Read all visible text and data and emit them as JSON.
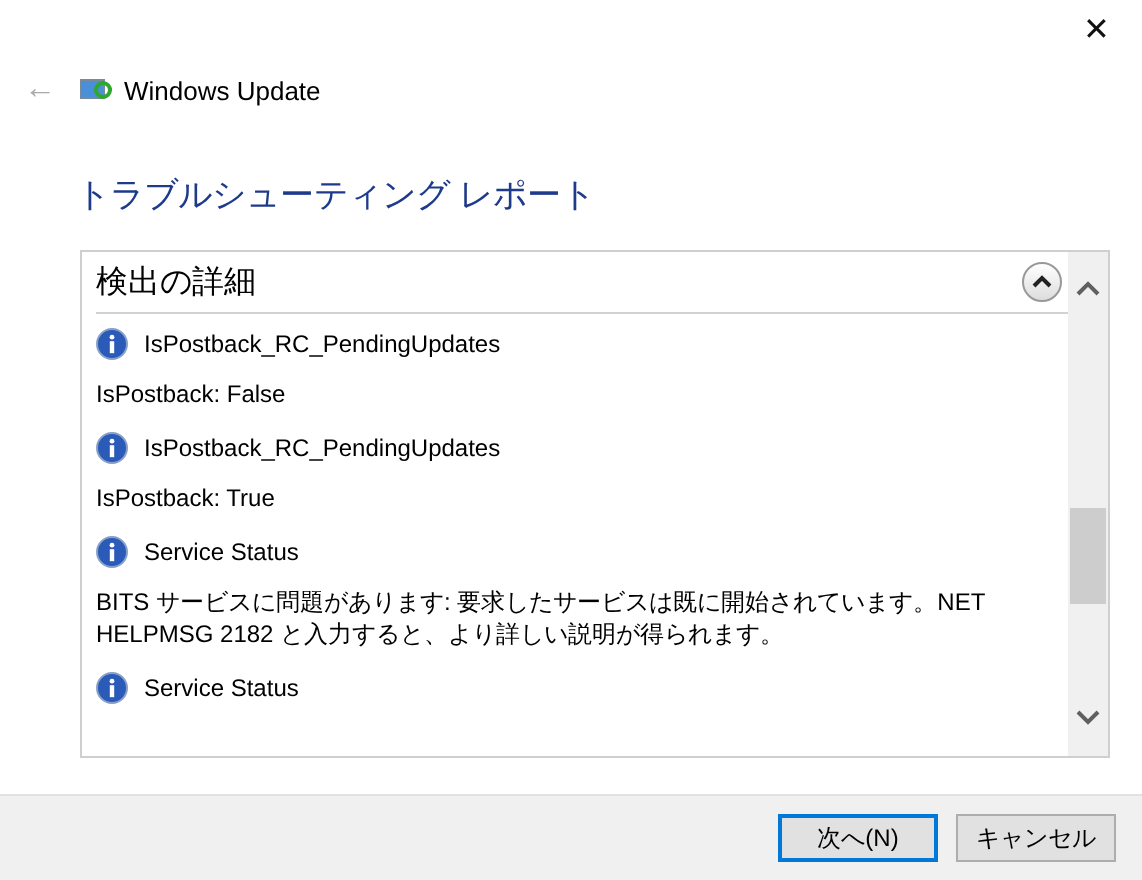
{
  "window": {
    "close": "✕",
    "back": "←",
    "title": "Windows Update"
  },
  "heading": "トラブルシューティング レポート",
  "panel": {
    "title": "検出の詳細",
    "expanded": true,
    "entries": [
      {
        "kind": "title",
        "text": "IsPostback_RC_PendingUpdates"
      },
      {
        "kind": "detail",
        "text": "IsPostback: False"
      },
      {
        "kind": "title",
        "text": "IsPostback_RC_PendingUpdates"
      },
      {
        "kind": "detail",
        "text": "IsPostback: True"
      },
      {
        "kind": "title",
        "text": "Service Status"
      },
      {
        "kind": "detail",
        "text": "BITS サービスに問題があります: 要求したサービスは既に開始されています。NET HELPMSG 2182 と入力すると、より詳しい説明が得られます。"
      },
      {
        "kind": "title",
        "text": "Service Status"
      }
    ]
  },
  "buttons": [
    {
      "label": "次へ(N)",
      "default": true
    },
    {
      "label": "キャンセル",
      "default": false
    }
  ]
}
